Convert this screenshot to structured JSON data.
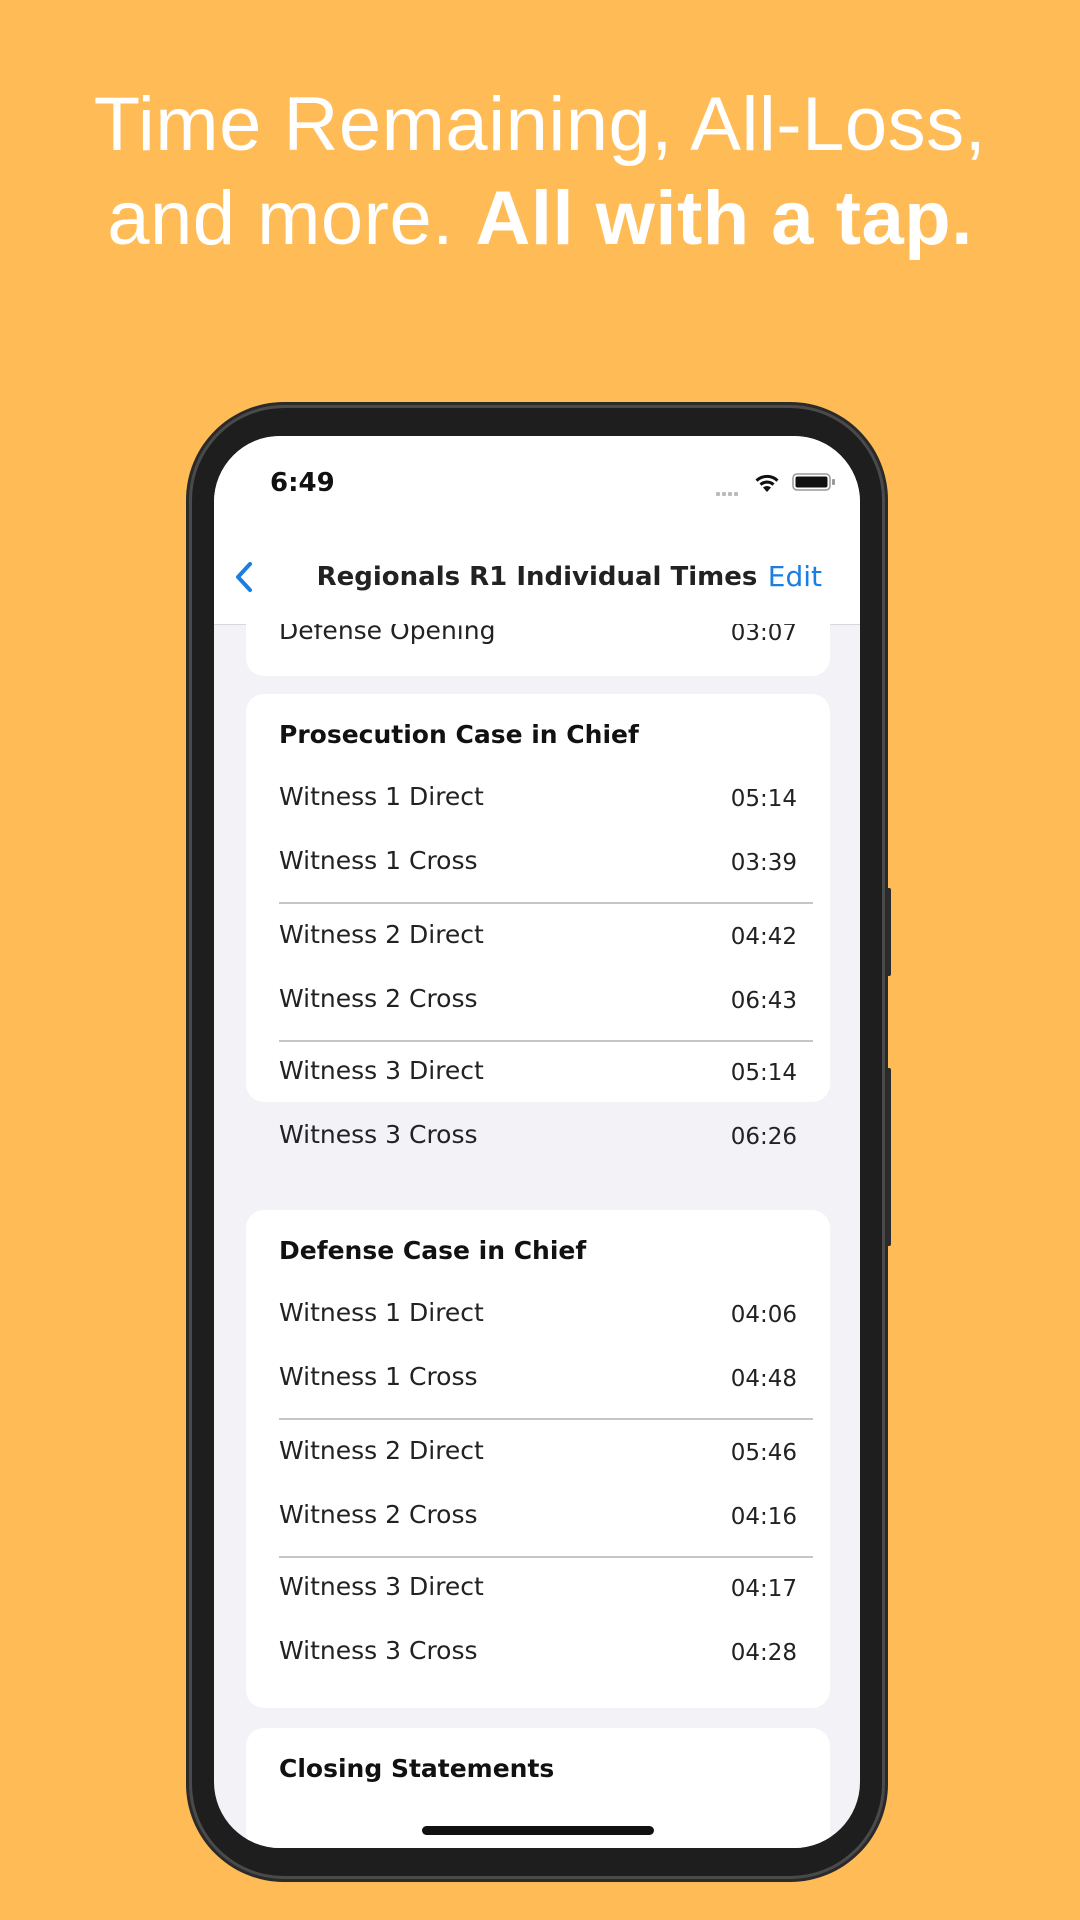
{
  "headline": {
    "regular_line1": "Time Remaining, All-Loss,",
    "regular_line2": "and more. ",
    "bold": "All with a tap."
  },
  "status_bar": {
    "time": "6:49"
  },
  "nav": {
    "title": "Regionals R1 Individual Times",
    "edit_label": "Edit",
    "back_icon": "chevron-left-icon"
  },
  "top_row": {
    "label": "Defense Opening",
    "value": "03:07"
  },
  "prosecution": {
    "title": "Prosecution Case in Chief",
    "rows": [
      {
        "label": "Witness 1 Direct",
        "value": "05:14"
      },
      {
        "label": "Witness 1 Cross",
        "value": "03:39"
      },
      {
        "label": "Witness 2 Direct",
        "value": "04:42"
      },
      {
        "label": "Witness 2 Cross",
        "value": "06:43"
      },
      {
        "label": "Witness 3 Direct",
        "value": "05:14"
      },
      {
        "label": "Witness 3 Cross",
        "value": "06:26"
      }
    ]
  },
  "defense": {
    "title": "Defense Case in Chief",
    "rows": [
      {
        "label": "Witness 1 Direct",
        "value": "04:06"
      },
      {
        "label": "Witness 1 Cross",
        "value": "04:48"
      },
      {
        "label": "Witness 2 Direct",
        "value": "05:46"
      },
      {
        "label": "Witness 2 Cross",
        "value": "04:16"
      },
      {
        "label": "Witness 3 Direct",
        "value": "04:17"
      },
      {
        "label": "Witness 3 Cross",
        "value": "04:28"
      }
    ]
  },
  "closing": {
    "title": "Closing Statements"
  },
  "colors": {
    "background": "#FFBB55",
    "accent": "#1A7FE0",
    "list_bg": "#F2F2F7"
  }
}
